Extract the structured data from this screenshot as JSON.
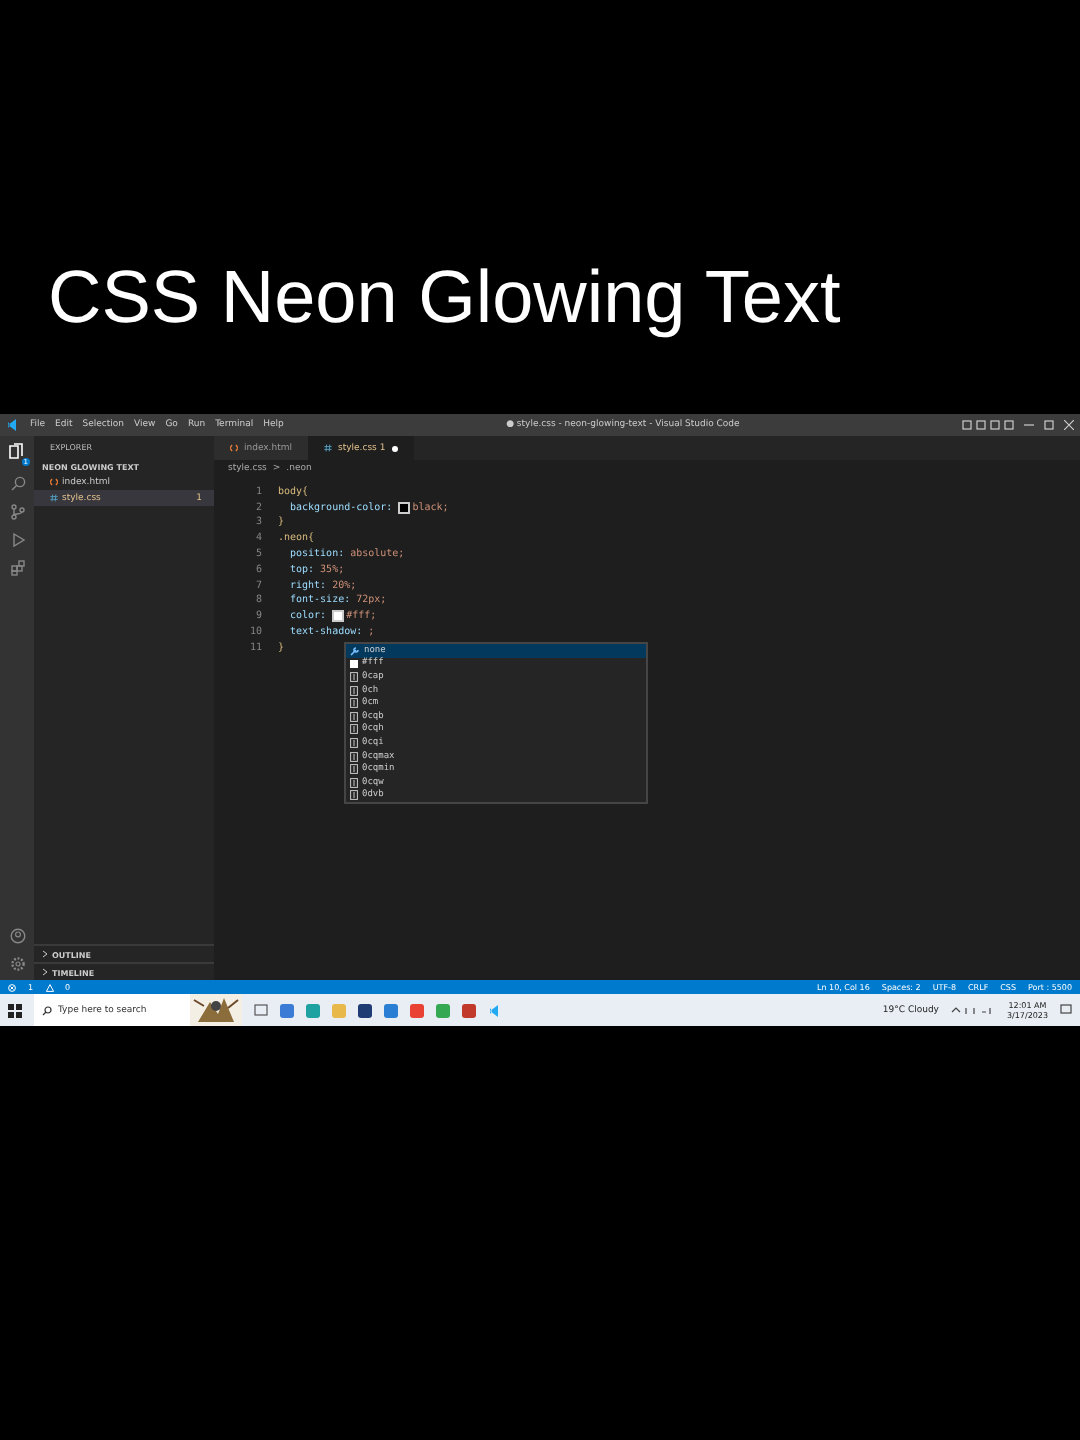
{
  "video_title": "CSS Neon Glowing Text",
  "window": {
    "title": "● style.css - neon-glowing-text - Visual Studio Code"
  },
  "menu": [
    "File",
    "Edit",
    "Selection",
    "View",
    "Go",
    "Run",
    "Terminal",
    "Help"
  ],
  "activity_bar": {
    "explorer_badge": "1"
  },
  "sidebar": {
    "title": "EXPLORER",
    "folder": "NEON GLOWING TEXT",
    "files": [
      {
        "name": "index.html",
        "kind": "html",
        "selected": false
      },
      {
        "name": "style.css",
        "kind": "css",
        "selected": true,
        "badge": "1"
      }
    ],
    "sections": [
      "OUTLINE",
      "TIMELINE"
    ]
  },
  "tabs": [
    {
      "label": "index.html",
      "kind": "html",
      "selected": false,
      "modified": false
    },
    {
      "label": "style.css 1",
      "kind": "css",
      "selected": true,
      "modified": true
    }
  ],
  "breadcrumb": [
    "style.css",
    ">",
    ".neon"
  ],
  "code": [
    {
      "num": "1",
      "kind": "selector",
      "text": "body{"
    },
    {
      "num": "2",
      "kind": "decl",
      "prop": "background-color:",
      "color": "#000000",
      "value": "black;"
    },
    {
      "num": "3",
      "kind": "brace",
      "text": "}"
    },
    {
      "num": "4",
      "kind": "selector",
      "text": ".neon{"
    },
    {
      "num": "5",
      "kind": "decl",
      "prop": "position:",
      "value": "absolute;"
    },
    {
      "num": "6",
      "kind": "decl",
      "prop": "top:",
      "value": "35%;"
    },
    {
      "num": "7",
      "kind": "decl",
      "prop": "right:",
      "value": "20%;"
    },
    {
      "num": "8",
      "kind": "decl",
      "prop": "font-size:",
      "value": "72px;"
    },
    {
      "num": "9",
      "kind": "decl",
      "prop": "color:",
      "color": "#ffffff",
      "value": "#fff;"
    },
    {
      "num": "10",
      "kind": "decl",
      "prop": "text-shadow:",
      "value": ";"
    },
    {
      "num": "11",
      "kind": "brace",
      "text": "}"
    }
  ],
  "suggestions": [
    {
      "label": "none",
      "kind": "keyword",
      "selected": true
    },
    {
      "label": "#fff",
      "kind": "color",
      "selected": false
    },
    {
      "label": "0cap",
      "kind": "unit",
      "selected": false
    },
    {
      "label": "0ch",
      "kind": "unit",
      "selected": false
    },
    {
      "label": "0cm",
      "kind": "unit",
      "selected": false
    },
    {
      "label": "0cqb",
      "kind": "unit",
      "selected": false
    },
    {
      "label": "0cqh",
      "kind": "unit",
      "selected": false
    },
    {
      "label": "0cqi",
      "kind": "unit",
      "selected": false
    },
    {
      "label": "0cqmax",
      "kind": "unit",
      "selected": false
    },
    {
      "label": "0cqmin",
      "kind": "unit",
      "selected": false
    },
    {
      "label": "0cqw",
      "kind": "unit",
      "selected": false
    },
    {
      "label": "0dvb",
      "kind": "unit",
      "selected": false
    }
  ],
  "status_bar": {
    "errors": "1",
    "warnings": "0",
    "items": [
      "Ln 10, Col 16",
      "Spaces: 2",
      "UTF-8",
      "CRLF",
      "CSS",
      "Port : 5500"
    ]
  },
  "taskbar": {
    "search_placeholder": "Type here to search",
    "weather": "19°C  Cloudy",
    "time": "12:01 AM",
    "date": "3/17/2023"
  }
}
